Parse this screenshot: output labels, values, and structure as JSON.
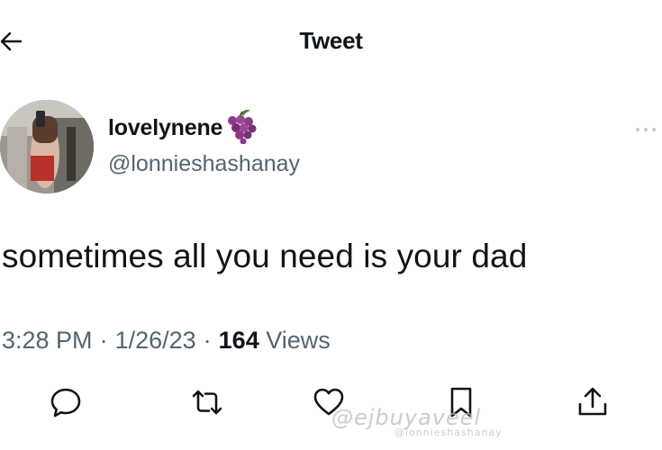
{
  "header": {
    "title": "Tweet",
    "back_icon": "arrow-left-icon"
  },
  "author": {
    "display_name": "lovelynene",
    "emoji": "grapes-icon",
    "handle": "@lonnieshashanay"
  },
  "tweet": {
    "text": "sometimes all you need is your dad",
    "time": "3:28 PM",
    "separator": "·",
    "date": "1/26/23",
    "views_count": "164",
    "views_label": "Views"
  },
  "actions": [
    "reply-icon",
    "retweet-icon",
    "like-icon",
    "bookmark-icon",
    "share-icon"
  ],
  "watermark": {
    "main": "@ejbuyaveel",
    "sub": "@lonnieshashanay"
  },
  "colors": {
    "text": "#0f1419",
    "secondary": "#536471",
    "icon": "#536471",
    "grapes": "#8e3a86"
  }
}
